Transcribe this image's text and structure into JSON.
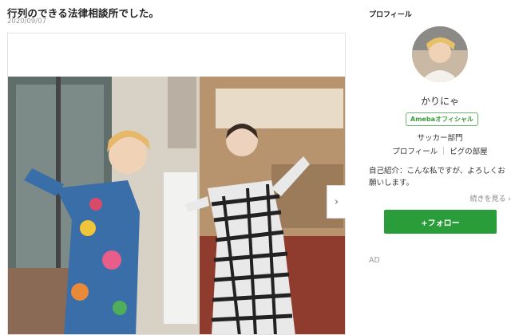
{
  "post": {
    "title": "行列のできる法律相談所でした。",
    "date": "2020/09/07",
    "next_icon": "chevron-right-icon"
  },
  "sidebar": {
    "heading": "プロフィール",
    "name": "かりにゃ",
    "badge": "Amebaオフィシャル",
    "subtitle": "サッカー部門",
    "links": [
      "プロフィール",
      "ピグの部屋"
    ],
    "intro": "自己紹介：こんな私ですが、よろしくお願いします。",
    "read_more": "続きを見る",
    "follow_button": "+フォロー",
    "ad_label": "AD",
    "colors": {
      "follow": "#2a9d3a",
      "badge": "#3a9a3a"
    }
  }
}
